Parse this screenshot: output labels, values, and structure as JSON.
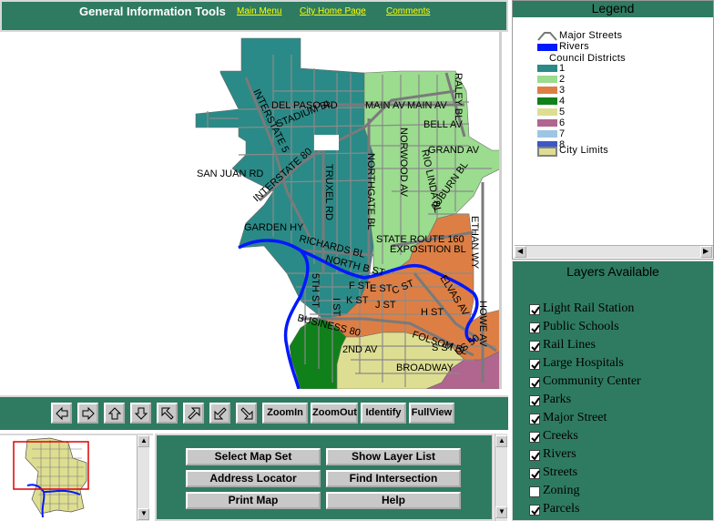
{
  "header": {
    "title": "General Information Tools",
    "links": [
      "Main Menu",
      "City Home Page",
      "Comments"
    ]
  },
  "map": {
    "street_labels": [
      "DEL PASO RD",
      "MAIN AV",
      "MAIN AV",
      "RALEY BL",
      "STADIUM BL",
      "BELL AV",
      "INTERSTATE 5",
      "NORWOOD AV",
      "GRAND AV",
      "INTERSTATE 80",
      "RIO LINDA BL",
      "SAN JUAN RD",
      "TRUXEL RD",
      "NORTHGATE BL",
      "AUBURN BL",
      "GARDEN HY",
      "ETHAN WY",
      "STATE ROUTE 160",
      "EXPOSITION BL",
      "RICHARDS BL",
      "NORTH B ST",
      "F ST",
      "E ST",
      "C ST",
      "ELVAS AV",
      "K ST",
      "J ST",
      "H ST",
      "5TH ST",
      "I ST",
      "BUSINESS 80",
      "FOLSOM BL",
      "2ND AV",
      "S ST",
      "US 50",
      "HOWE AV",
      "BROADWAY"
    ],
    "colors": {
      "district1": "#2a8a87",
      "district2": "#9bdc8e",
      "district3": "#dd7f45",
      "district4": "#10801a",
      "district5": "#dede92",
      "district6": "#b0668e",
      "streets": "#8a8a8a",
      "rivers": "#0018ff"
    }
  },
  "toolbar": {
    "icons": [
      "pan-west-icon",
      "pan-east-icon",
      "pan-north-icon",
      "pan-south-icon",
      "pan-northwest-icon",
      "pan-northeast-icon",
      "pan-southwest-icon",
      "pan-southeast-icon"
    ],
    "buttons": [
      "ZoomIn",
      "ZoomOut",
      "Identify",
      "FullView"
    ]
  },
  "commands": {
    "select_map_set": "Select Map Set",
    "show_layer_list": "Show Layer List",
    "address_locator": "Address Locator",
    "find_intersection": "Find Intersection",
    "print_map": "Print Map",
    "help": "Help"
  },
  "legend": {
    "title": "Legend",
    "major_streets": "Major Streets",
    "rivers": "Rivers",
    "council_districts": "Council Districts",
    "districts": [
      {
        "label": "1",
        "color": "#2a8a87"
      },
      {
        "label": "2",
        "color": "#9bdc8e"
      },
      {
        "label": "3",
        "color": "#dd7f45"
      },
      {
        "label": "4",
        "color": "#10801a"
      },
      {
        "label": "5",
        "color": "#dede92"
      },
      {
        "label": "6",
        "color": "#b0668e"
      },
      {
        "label": "7",
        "color": "#9ec6e4"
      },
      {
        "label": "8",
        "color": "#3d57c4"
      }
    ],
    "city_limits": "City Limits",
    "city_limits_color": "#dede92"
  },
  "layers": {
    "title": "Layers Available",
    "items": [
      {
        "label": "Light Rail Station",
        "checked": true
      },
      {
        "label": "Public Schools",
        "checked": true
      },
      {
        "label": "Rail Lines",
        "checked": true
      },
      {
        "label": "Large Hospitals",
        "checked": true
      },
      {
        "label": "Community Center",
        "checked": true
      },
      {
        "label": "Parks",
        "checked": true
      },
      {
        "label": "Major Street",
        "checked": true
      },
      {
        "label": "Creeks",
        "checked": true
      },
      {
        "label": "Rivers",
        "checked": true
      },
      {
        "label": "Streets",
        "checked": true
      },
      {
        "label": "Zoning",
        "checked": false
      },
      {
        "label": "Parcels",
        "checked": true
      }
    ]
  }
}
